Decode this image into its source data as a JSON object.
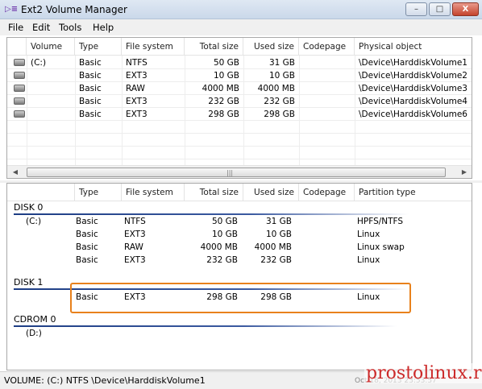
{
  "window": {
    "title": "Ext2 Volume Manager",
    "icon": "ext2-app-icon",
    "min": "–",
    "max": "□",
    "close": "X"
  },
  "menu": [
    "File",
    "Edit",
    "Tools",
    "Help"
  ],
  "volumes": {
    "columns": [
      "Volume",
      "Type",
      "File system",
      "Total size",
      "Used size",
      "Codepage",
      "Physical object"
    ],
    "rows": [
      {
        "volume": "(C:)",
        "type": "Basic",
        "fs": "NTFS",
        "total": "50 GB",
        "used": "31 GB",
        "codepage": "",
        "object": "\\Device\\HarddiskVolume1",
        "icon": "hard-disk-icon"
      },
      {
        "volume": "",
        "type": "Basic",
        "fs": "EXT3",
        "total": "10 GB",
        "used": "10 GB",
        "codepage": "",
        "object": "\\Device\\HarddiskVolume2",
        "icon": "hard-disk-icon"
      },
      {
        "volume": "",
        "type": "Basic",
        "fs": "RAW",
        "total": "4000 MB",
        "used": "4000 MB",
        "codepage": "",
        "object": "\\Device\\HarddiskVolume3",
        "icon": "hard-disk-icon"
      },
      {
        "volume": "",
        "type": "Basic",
        "fs": "EXT3",
        "total": "232 GB",
        "used": "232 GB",
        "codepage": "",
        "object": "\\Device\\HarddiskVolume4",
        "icon": "hard-disk-icon"
      },
      {
        "volume": "",
        "type": "Basic",
        "fs": "EXT3",
        "total": "298 GB",
        "used": "298 GB",
        "codepage": "",
        "object": "\\Device\\HarddiskVolume6",
        "icon": "hard-disk-icon"
      }
    ],
    "scroll_grip": "|||"
  },
  "disks": {
    "columns": [
      "Type",
      "File system",
      "Total size",
      "Used size",
      "Codepage",
      "Partition type"
    ],
    "groups": [
      {
        "label": "DISK 0",
        "rows": [
          {
            "volume": "(C:)",
            "type": "Basic",
            "fs": "NTFS",
            "total": "50 GB",
            "used": "31 GB",
            "ptype": "HPFS/NTFS"
          },
          {
            "volume": "",
            "type": "Basic",
            "fs": "EXT3",
            "total": "10 GB",
            "used": "10 GB",
            "ptype": "Linux"
          },
          {
            "volume": "",
            "type": "Basic",
            "fs": "RAW",
            "total": "4000 MB",
            "used": "4000 MB",
            "ptype": "Linux swap"
          },
          {
            "volume": "",
            "type": "Basic",
            "fs": "EXT3",
            "total": "232 GB",
            "used": "232 GB",
            "ptype": "Linux"
          }
        ]
      },
      {
        "label": "DISK 1",
        "rows": [
          {
            "volume": "",
            "type": "Basic",
            "fs": "EXT3",
            "total": "298 GB",
            "used": "298 GB",
            "ptype": "Linux"
          }
        ]
      },
      {
        "label": "CDROM 0",
        "rows": [
          {
            "volume": "(D:)",
            "type": "",
            "fs": "",
            "total": "",
            "used": "",
            "ptype": ""
          }
        ]
      }
    ],
    "highlight_color": "#e8811c"
  },
  "status": {
    "text": "VOLUME: (C:) NTFS \\Device\\HarddiskVolume1",
    "ghost": "Oct 18, 2013 23:53:57"
  },
  "watermark": "prostolinux.ru",
  "colors": {
    "disk_line": "#1d3d84",
    "close_btn": "#c4442d"
  }
}
